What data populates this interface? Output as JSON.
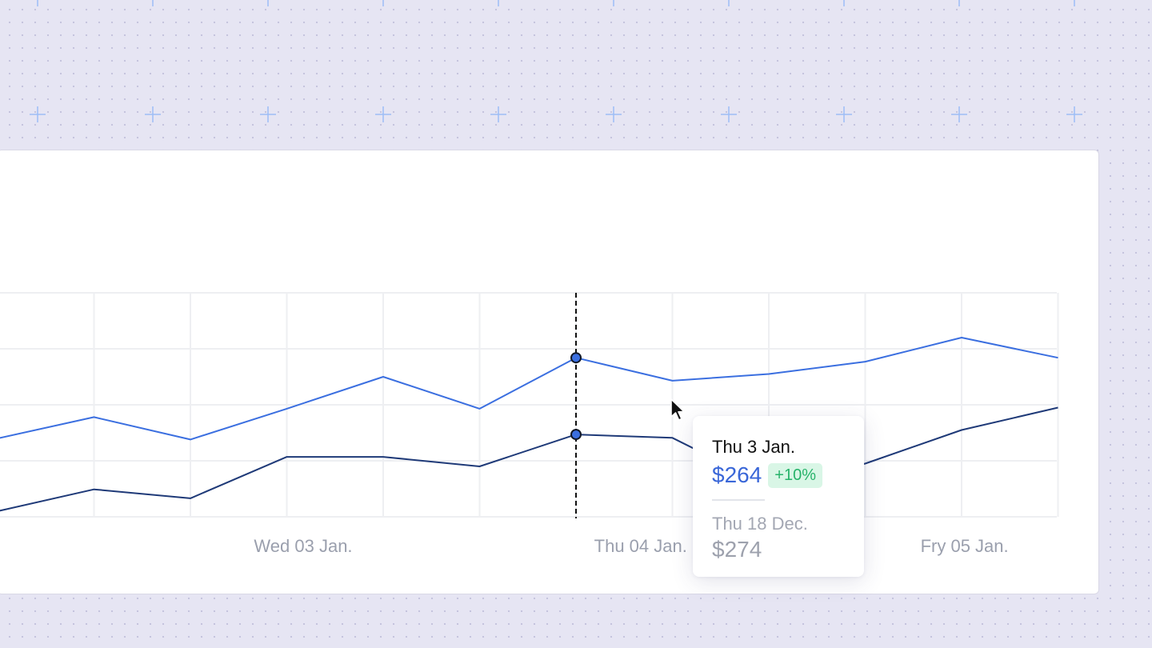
{
  "chart_data": {
    "type": "line",
    "x": [
      0,
      1,
      2,
      3,
      4,
      5,
      6,
      7,
      8,
      9,
      10,
      11
    ],
    "x_tick_labels": [
      {
        "x": 3.17,
        "label": "Wed 03 Jan."
      },
      {
        "x": 6.67,
        "label": "Thu 04 Jan."
      },
      {
        "x": 10.03,
        "label": "Fry 05 Jan."
      }
    ],
    "ylim": [
      0,
      4
    ],
    "grid": true,
    "series": [
      {
        "color": "#3b6fe0",
        "values": [
          1.4,
          1.78,
          1.38,
          1.93,
          2.5,
          1.93,
          2.84,
          2.43,
          2.55,
          2.77,
          3.2,
          2.84
        ]
      },
      {
        "color": "#1f3a78",
        "values": [
          0.1,
          0.49,
          0.33,
          1.07,
          1.07,
          0.9,
          1.47,
          1.41,
          0.55,
          0.95,
          1.55,
          1.95
        ]
      }
    ],
    "hover": {
      "index": 6,
      "tooltip": {
        "date": "Thu 3 Jan.",
        "value": "$264",
        "change": "+10%",
        "compare_date": "Thu 18 Dec.",
        "compare_value": "$274"
      }
    }
  },
  "colors": {
    "series_primary": "#3b6fe0",
    "series_secondary": "#1f3a78",
    "grid": "#eeeff2",
    "tick_text": "#9a9fad",
    "badge_bg": "#d9f6e6",
    "badge_text": "#27b36a",
    "background_marks": "#9dbdf6"
  }
}
